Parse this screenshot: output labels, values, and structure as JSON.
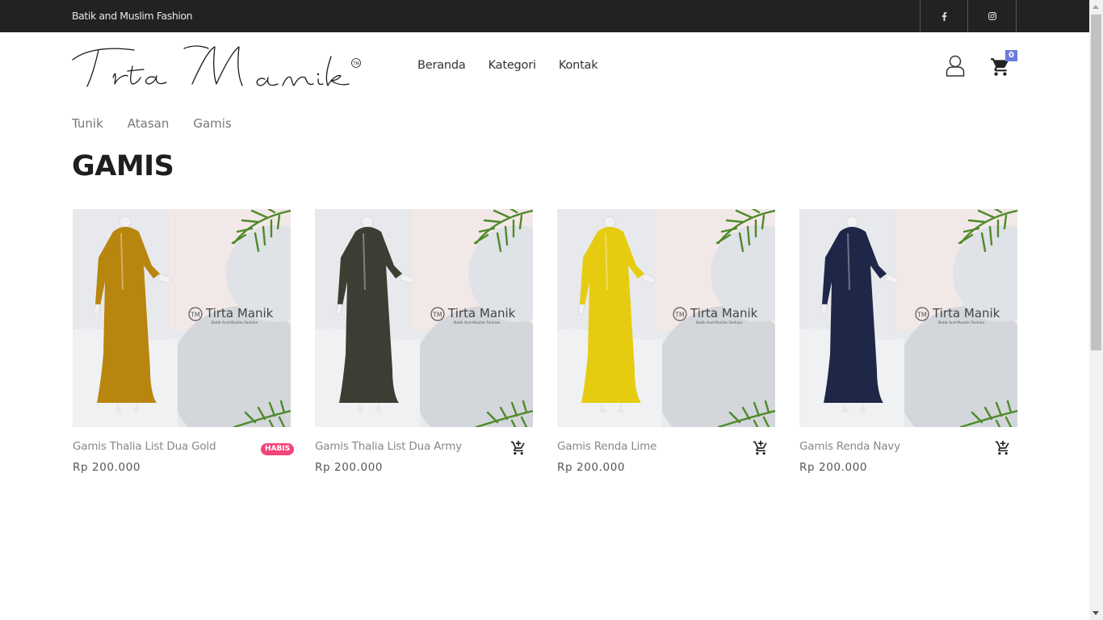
{
  "topbar": {
    "tagline": "Batik and Muslim Fashion",
    "social": [
      {
        "icon": "facebook-icon"
      },
      {
        "icon": "instagram-icon"
      }
    ]
  },
  "header": {
    "logo_text": "Tirta Manik",
    "logo_mark": "TM",
    "nav": [
      "Beranda",
      "Kategori",
      "Kontak"
    ],
    "cart_count": "0"
  },
  "subnav": [
    "Tunik",
    "Atasan",
    "Gamis"
  ],
  "page_title": "GAMIS",
  "brand_watermark": {
    "name": "Tirta Manik",
    "tagline": "Batik And Muslim Fashion"
  },
  "products": [
    {
      "name": "Gamis Thalia List Dua Gold",
      "price": "Rp 200.000",
      "badge": "HABIS",
      "dress_color": "#b8860f"
    },
    {
      "name": "Gamis Thalia List Dua Army",
      "price": "Rp 200.000",
      "badge": null,
      "dress_color": "#3e3d33"
    },
    {
      "name": "Gamis Renda Lime",
      "price": "Rp 200.000",
      "badge": null,
      "dress_color": "#e6cc10"
    },
    {
      "name": "Gamis Renda Navy",
      "price": "Rp 200.000",
      "badge": null,
      "dress_color": "#1f2748"
    }
  ],
  "colors": {
    "topbar": "#222222",
    "badge": "#f1467a",
    "cart_badge": "#6c7ae0"
  }
}
